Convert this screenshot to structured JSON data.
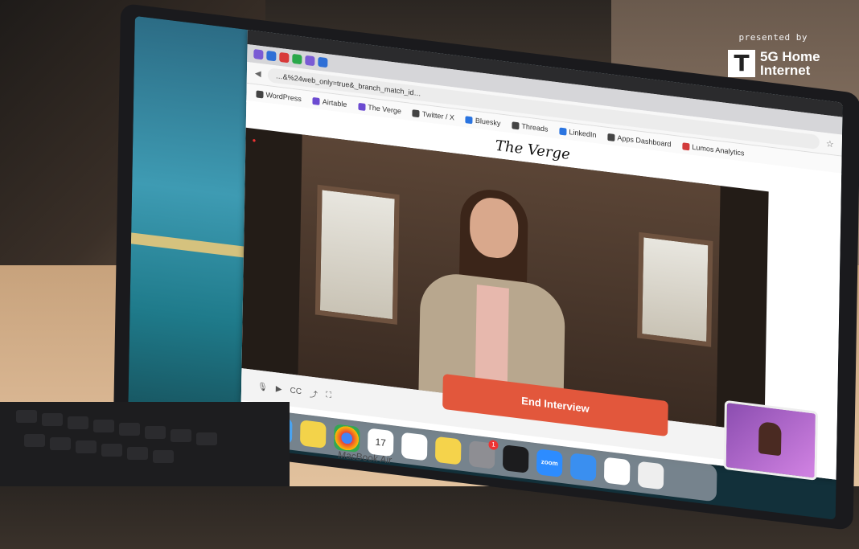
{
  "overlay": {
    "presented_by": "presented by",
    "brand_logo": "T",
    "brand_line1": "5G Home",
    "brand_line2": "Internet"
  },
  "browser": {
    "url": "…&%24web_only=true&_branch_match_id…",
    "bookmarks": [
      {
        "label": "WordPress",
        "icon": "wordpress-icon"
      },
      {
        "label": "Airtable",
        "icon": "airtable-icon"
      },
      {
        "label": "The Verge",
        "icon": "verge-icon"
      },
      {
        "label": "Twitter / X",
        "icon": "x-icon"
      },
      {
        "label": "Bluesky",
        "icon": "bluesky-icon"
      },
      {
        "label": "Threads",
        "icon": "threads-icon"
      },
      {
        "label": "LinkedIn",
        "icon": "linkedin-icon"
      },
      {
        "label": "Apps Dashboard",
        "icon": "apps-icon"
      },
      {
        "label": "Lumos Analytics",
        "icon": "lumos-icon"
      }
    ]
  },
  "page": {
    "site_logo": "The Verge",
    "end_button": "End Interview"
  },
  "dock": {
    "calendar_day": "17",
    "notification_count": "1",
    "zoom_label": "zoom"
  },
  "device": {
    "model": "MacBook Air"
  }
}
